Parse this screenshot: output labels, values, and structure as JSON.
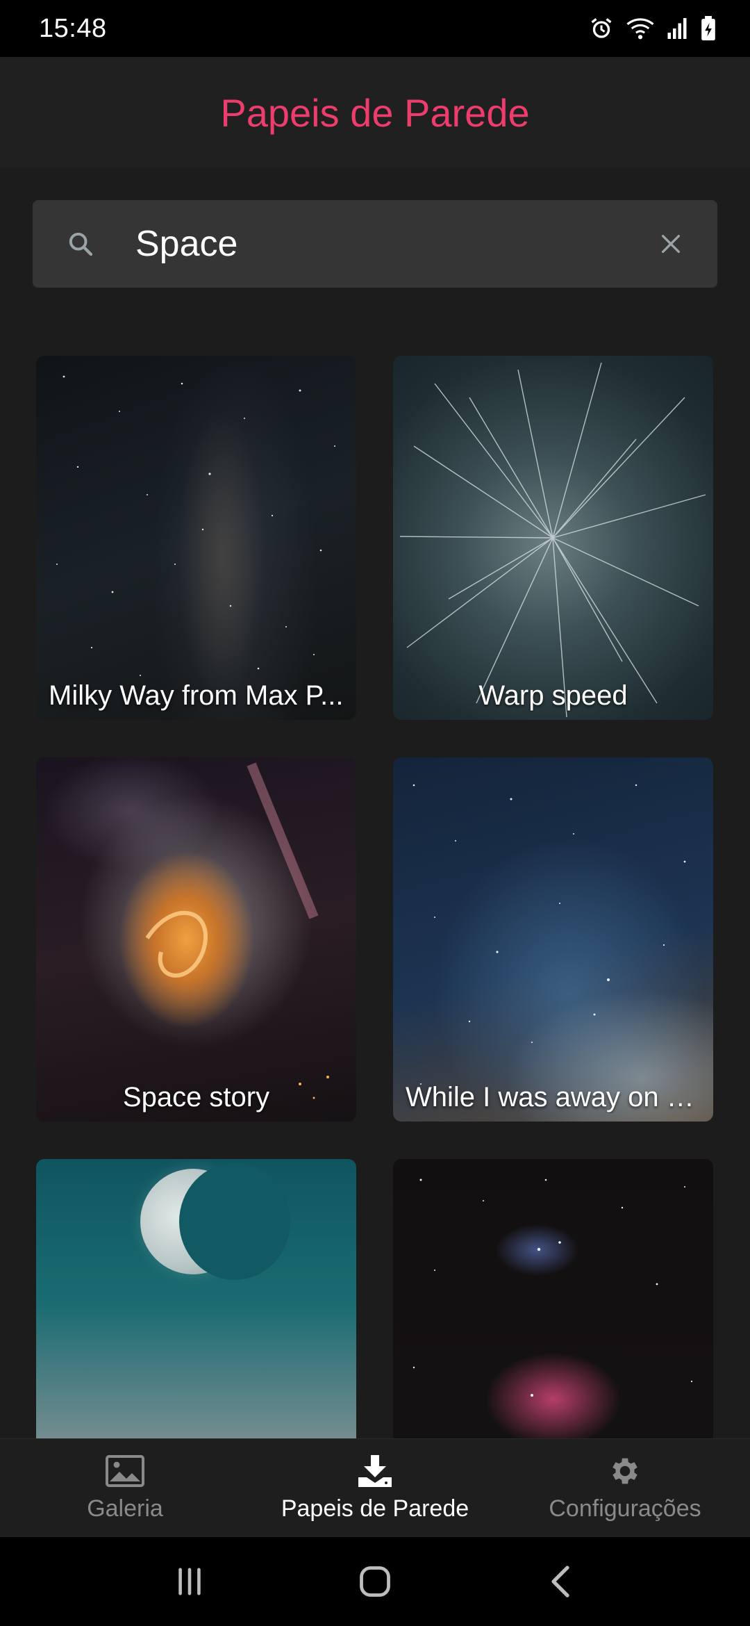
{
  "status_bar": {
    "time": "15:48",
    "icons": [
      "alarm-icon",
      "wifi-icon",
      "signal-icon",
      "battery-charging-icon"
    ]
  },
  "app_bar": {
    "title": "Papeis de Parede"
  },
  "search": {
    "value": "Space",
    "icon": "search-icon",
    "clear_icon": "close-icon"
  },
  "wallpapers": [
    {
      "title": "Milky Way from Max P..."
    },
    {
      "title": "Warp speed"
    },
    {
      "title": "Space story"
    },
    {
      "title": "While I was away on a..."
    },
    {
      "title": ""
    },
    {
      "title": ""
    }
  ],
  "bottom_nav": {
    "items": [
      {
        "label": "Galeria",
        "icon": "image-icon",
        "active": false
      },
      {
        "label": "Papeis de Parede",
        "icon": "download-icon",
        "active": true
      },
      {
        "label": "Configurações",
        "icon": "gear-icon",
        "active": false
      }
    ]
  },
  "system_nav": {
    "icons": [
      "recent-apps-icon",
      "home-icon",
      "back-icon"
    ]
  },
  "colors": {
    "accent": "#ec3d6c",
    "background": "#1c1c1c",
    "search_bg": "#353535"
  }
}
